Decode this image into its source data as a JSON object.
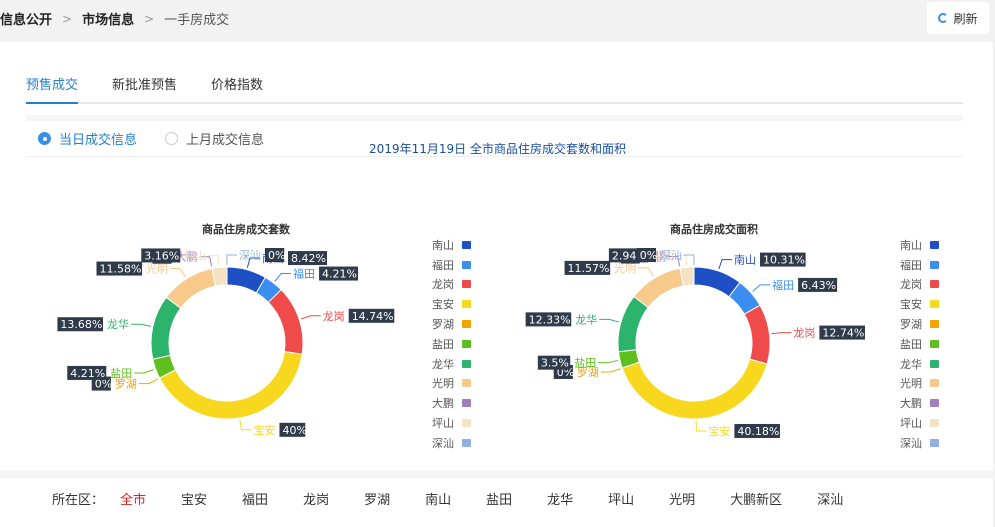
{
  "breadcrumb": [
    "信息公开",
    "市场信息",
    "一手房成交"
  ],
  "refresh_label": "刷新",
  "tabs": [
    {
      "label": "预售成交",
      "active": true
    },
    {
      "label": "新批准预售",
      "active": false
    },
    {
      "label": "价格指数",
      "active": false
    }
  ],
  "radios": [
    {
      "label": "当日成交信息",
      "checked": true
    },
    {
      "label": "上月成交信息",
      "checked": false
    }
  ],
  "main_title": "2019年11月19日 全市商品住房成交套数和面积",
  "colors": {
    "南山": "#1f4fc4",
    "福田": "#3b8df0",
    "龙岗": "#f04b4b",
    "宝安": "#f7d81e",
    "罗湖": "#f0a500",
    "盐田": "#5fbf1f",
    "龙华": "#2cb36c",
    "光明": "#f7c98a",
    "大鹏": "#a07fc0",
    "坪山": "#f5e2c2",
    "深汕": "#8fb0e0"
  },
  "chart_data": [
    {
      "type": "pie",
      "title": "商品住房成交套数",
      "categories": [
        "南山",
        "福田",
        "龙岗",
        "宝安",
        "罗湖",
        "盐田",
        "龙华",
        "光明",
        "大鹏",
        "坪山",
        "深汕"
      ],
      "values": [
        8.42,
        4.21,
        14.74,
        40,
        0,
        4.21,
        13.68,
        11.58,
        0,
        3.16,
        0
      ],
      "labels": [
        "8.42%",
        "4.21%",
        "14.74%",
        "40%",
        "0%",
        "4.21%",
        "13.68%",
        "11.58%",
        "0%",
        "3.16%",
        "0%"
      ],
      "legend": "right"
    },
    {
      "type": "pie",
      "title": "商品住房成交面积",
      "categories": [
        "南山",
        "福田",
        "龙岗",
        "宝安",
        "罗湖",
        "盐田",
        "龙华",
        "光明",
        "大鹏",
        "坪山",
        "深汕"
      ],
      "values": [
        10.31,
        6.43,
        12.74,
        40.18,
        0,
        3.5,
        12.33,
        11.57,
        0,
        2.94,
        0
      ],
      "labels": [
        "10.31%",
        "6.43%",
        "12.74%",
        "40.18%",
        "0%",
        "3.5%",
        "12.33%",
        "11.57%",
        "0%",
        "2.94%",
        "0%"
      ],
      "legend": "right"
    }
  ],
  "district_label": "所在区：",
  "districts": [
    {
      "label": "全市",
      "active": true
    },
    {
      "label": "宝安",
      "active": false
    },
    {
      "label": "福田",
      "active": false
    },
    {
      "label": "龙岗",
      "active": false
    },
    {
      "label": "罗湖",
      "active": false
    },
    {
      "label": "南山",
      "active": false
    },
    {
      "label": "盐田",
      "active": false
    },
    {
      "label": "龙华",
      "active": false
    },
    {
      "label": "坪山",
      "active": false
    },
    {
      "label": "光明",
      "active": false
    },
    {
      "label": "大鹏新区",
      "active": false
    },
    {
      "label": "深汕",
      "active": false
    }
  ]
}
